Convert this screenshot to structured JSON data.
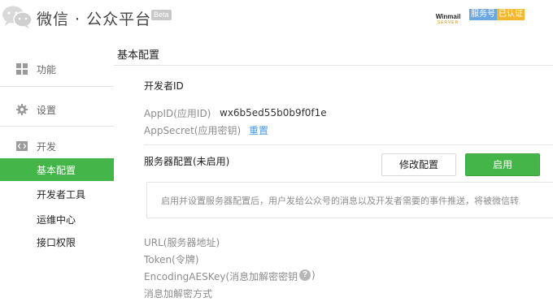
{
  "header": {
    "logo_text": "微信 · 公众平台",
    "beta_label": "Beta",
    "winmail_brand": "Winmail",
    "winmail_sub": "SERVER",
    "account_type_badge": "服务号",
    "verified_badge": "已认证"
  },
  "sidebar": {
    "sections": [
      {
        "label": "功能",
        "icon": "grid-icon"
      },
      {
        "label": "设置",
        "icon": "gear-icon"
      },
      {
        "label": "开发",
        "icon": "code-icon"
      }
    ],
    "items": [
      {
        "label": "基本配置",
        "active": true
      },
      {
        "label": "开发者工具",
        "active": false
      },
      {
        "label": "运维中心",
        "active": false
      },
      {
        "label": "接口权限",
        "active": false
      }
    ]
  },
  "main": {
    "title": "基本配置",
    "developer_section_title": "开发者ID",
    "appid_label": "AppID(应用ID)",
    "appid_value": "wx6b5ed55b0b9f0f1e",
    "appsecret_label": "AppSecret(应用密钥)",
    "reset_link": "重置",
    "server_config_title": "服务器配置(未启用)",
    "modify_button": "修改配置",
    "enable_button": "启用",
    "tip_text": "启用并设置服务器配置后，用户发给公众号的消息以及开发者需要的事件推送，将被微信转",
    "url_label": "URL(服务器地址)",
    "token_label": "Token(令牌)",
    "aeskey_label": "EncodingAESKey(消息加解密密钥",
    "aeskey_label_close": ")",
    "help_glyph": "?",
    "encrypt_mode_label": "消息加解密方式"
  },
  "colors": {
    "accent_green": "#44b549",
    "link_blue": "#459ae9",
    "service_badge": "#6aa7e3",
    "verified_badge": "#f5b72d"
  }
}
